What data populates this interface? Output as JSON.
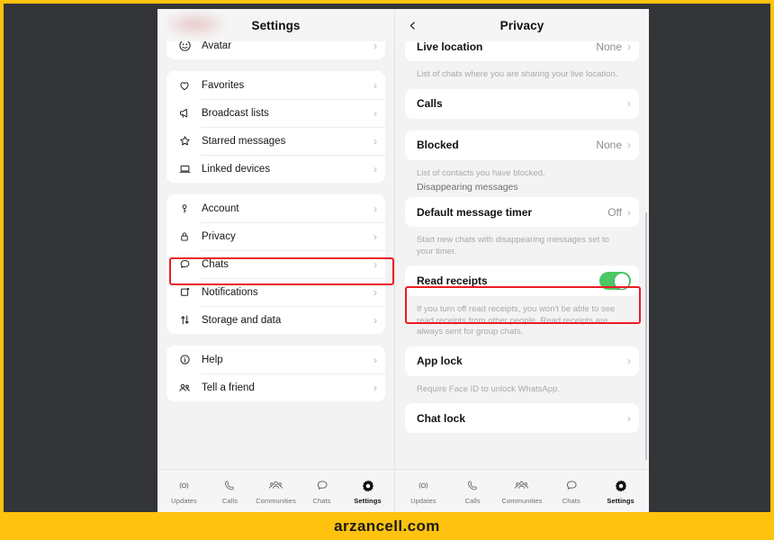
{
  "branding": {
    "text": "arzancell.com"
  },
  "settings_panel": {
    "nav": {
      "title": "Settings",
      "back_icon": "chevron-left-icon"
    },
    "groups": [
      {
        "id": "profile",
        "rows": [
          {
            "icon": "avatar-icon",
            "label": "Avatar",
            "value": "",
            "chevron": "›"
          }
        ]
      },
      {
        "id": "shortcuts",
        "rows": [
          {
            "icon": "heart-icon",
            "label": "Favorites",
            "value": "",
            "chevron": "›"
          },
          {
            "icon": "megaphone-icon",
            "label": "Broadcast lists",
            "value": "",
            "chevron": "›"
          },
          {
            "icon": "star-icon",
            "label": "Starred messages",
            "value": "",
            "chevron": "›"
          },
          {
            "icon": "laptop-icon",
            "label": "Linked devices",
            "value": "",
            "chevron": "›"
          }
        ]
      },
      {
        "id": "preferences",
        "rows": [
          {
            "icon": "key-icon",
            "label": "Account",
            "value": "",
            "chevron": "›"
          },
          {
            "icon": "lock-icon",
            "label": "Privacy",
            "value": "",
            "chevron": "›"
          },
          {
            "icon": "chat-bubble-icon",
            "label": "Chats",
            "value": "",
            "chevron": "›"
          },
          {
            "icon": "notification-icon",
            "label": "Notifications",
            "value": "",
            "chevron": "›"
          },
          {
            "icon": "arrows-updown-icon",
            "label": "Storage and data",
            "value": "",
            "chevron": "›"
          }
        ]
      },
      {
        "id": "support",
        "rows": [
          {
            "icon": "info-circle-icon",
            "label": "Help",
            "value": "",
            "chevron": "›"
          },
          {
            "icon": "people-icon",
            "label": "Tell a friend",
            "value": "",
            "chevron": "›"
          }
        ]
      }
    ],
    "tabs": [
      {
        "icon": "updates-icon",
        "label": "Updates",
        "active": false
      },
      {
        "icon": "phone-icon",
        "label": "Calls",
        "active": false
      },
      {
        "icon": "communities-icon",
        "label": "Communities",
        "active": false
      },
      {
        "icon": "chats-icon",
        "label": "Chats",
        "active": false
      },
      {
        "icon": "settings-gear-icon",
        "label": "Settings",
        "active": true
      }
    ]
  },
  "privacy_panel": {
    "nav": {
      "title": "Privacy",
      "back_icon": "chevron-left-icon"
    },
    "rows": {
      "live_location": {
        "label": "Live location",
        "value": "None",
        "chevron": "›"
      },
      "live_location_help": "List of chats where you are sharing your live location.",
      "calls": {
        "label": "Calls",
        "value": "",
        "chevron": "›"
      },
      "blocked": {
        "label": "Blocked",
        "value": "None",
        "chevron": "›"
      },
      "blocked_help": "List of contacts you have blocked.",
      "disappearing_section": "Disappearing messages",
      "default_timer": {
        "label": "Default message timer",
        "value": "Off",
        "chevron": "›"
      },
      "default_timer_help": "Start new chats with disappearing messages set to your timer.",
      "read_receipts": {
        "label": "Read receipts",
        "toggle_on": true,
        "toggle_color": "#4CC764"
      },
      "read_receipts_help": "If you turn off read receipts, you won't be able to see read receipts from other people. Read receipts are always sent for group chats.",
      "app_lock": {
        "label": "App lock",
        "value": "",
        "chevron": "›"
      },
      "app_lock_help": "Require Face ID to unlock WhatsApp.",
      "chat_lock": {
        "label": "Chat lock",
        "value": "",
        "chevron": "›"
      }
    },
    "tabs": [
      {
        "icon": "updates-icon",
        "label": "Updates",
        "active": false
      },
      {
        "icon": "phone-icon",
        "label": "Calls",
        "active": false
      },
      {
        "icon": "communities-icon",
        "label": "Communities",
        "active": false
      },
      {
        "icon": "chats-icon",
        "label": "Chats",
        "active": false
      },
      {
        "icon": "settings-gear-icon",
        "label": "Settings",
        "active": true
      }
    ]
  },
  "highlights": {
    "color": "#ED1C24",
    "privacy_row": "Privacy",
    "read_receipts_row": "Read receipts"
  },
  "colors": {
    "frame": "#FFC20E",
    "backdrop": "#333538",
    "panel_bg": "#f3f3f3",
    "card": "#ffffff",
    "toggle_green": "#4CC764",
    "highlight_red": "#ED1C24"
  }
}
